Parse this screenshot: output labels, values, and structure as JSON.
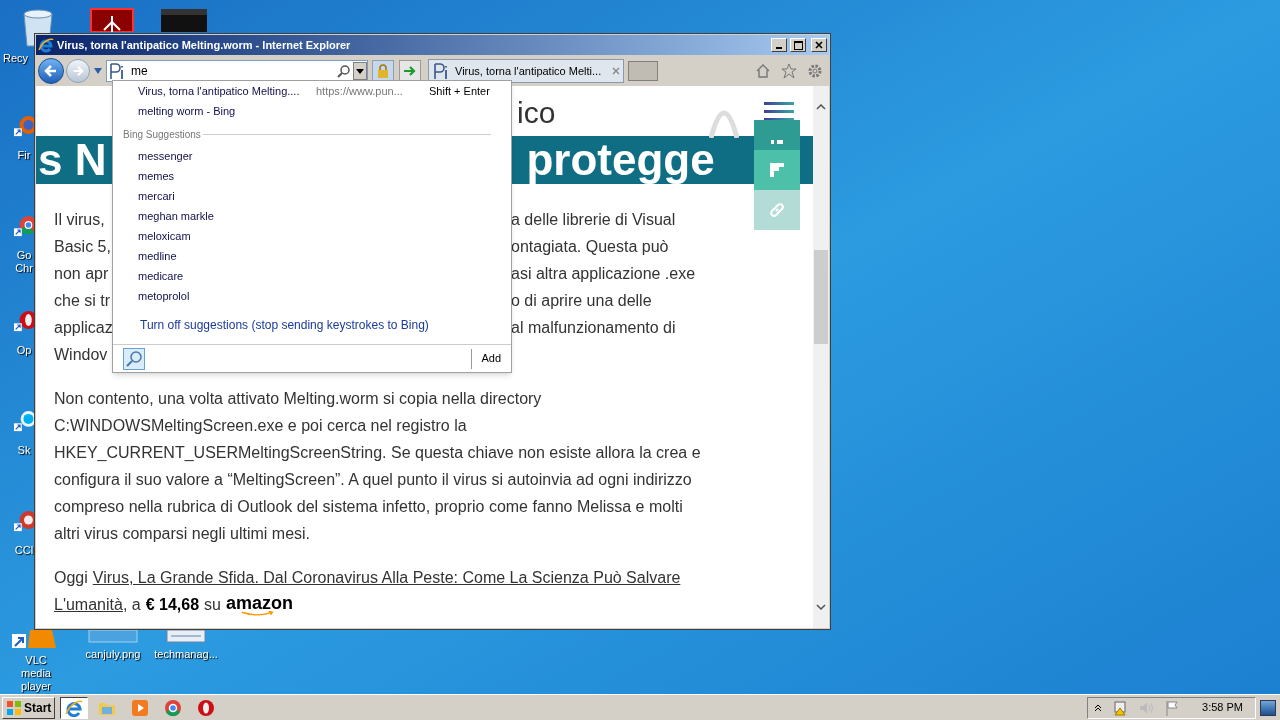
{
  "desktop": {
    "icons": [
      {
        "kind": "recycle",
        "label": "Recy"
      },
      {
        "kind": "pdf"
      },
      {
        "kind": "dark"
      },
      {
        "kind": "firefox",
        "label": "Fir"
      },
      {
        "kind": "chrome",
        "label": "Go Chr"
      },
      {
        "kind": "opera",
        "label": "Op"
      },
      {
        "kind": "skype",
        "label": "Sk"
      },
      {
        "kind": "ccleaner",
        "label": "CCl"
      },
      {
        "kind": "vlc",
        "label": "VLC media player"
      },
      {
        "kind": "image",
        "label": "canjuly.png"
      },
      {
        "kind": "doc",
        "label": "techmanag..."
      }
    ]
  },
  "window": {
    "title": "Virus, torna l'antipatico Melting.worm - Internet Explorer"
  },
  "toolbar": {
    "address": {
      "value": "me"
    },
    "tabs": [
      {
        "label": "Virus, torna l'antipatico Melti...",
        "selected": true
      }
    ]
  },
  "autocomplete": {
    "history": [
      {
        "title": "Virus, torna l'antipatico Melting....",
        "url": "https://www.pun...",
        "hint": "Shift + Enter"
      },
      {
        "title": "melting worm - Bing"
      }
    ],
    "section": "Bing Suggestions",
    "suggestions": [
      "messenger",
      "memes",
      "mercari",
      "meghan markle",
      "meloxicam",
      "medline",
      "medicare",
      "metoprolol"
    ],
    "turn_off": "Turn off suggestions (stop sending keystrokes to Bing)",
    "add": "Add"
  },
  "page": {
    "site_title": "ico",
    "banner": {
      "headline_left": "s N",
      "headline_right": "protegge"
    },
    "lines": [
      {
        "left": "Il virus,",
        "right": "a delle librerie di Visual"
      },
      {
        "left": "Basic 5,",
        "right": "ontagiata. Questa può"
      },
      {
        "left": "non apr",
        "right": "asi altra applicazione .exe"
      },
      {
        "left": "che si tr",
        "right": "o di aprire una delle"
      },
      {
        "left": "applicaz",
        "right": "al malfunzionamento di"
      },
      {
        "left": "Windov"
      }
    ],
    "paragraph": "Non contento, una volta attivato Melting.worm si copia nella directory C:WINDOWSMeltingScreen.exe e poi cerca nel registro la HKEY_CURRENT_USERMeltingScreenString. Se questa chiave non esiste allora la crea e configura il suo valore a “MeltingScreen”. A quel punto il virus si autoinvia ad ogni indirizzo compreso nella rubrica di Outlook del sistema infetto, proprio come fanno Melissa e molti altri virus comparsi negli ultimi mesi.",
    "promo": {
      "prefix": "Oggi",
      "link_lines": [
        "Virus, La Grande Sfida. Dal Coronavirus Alla Peste: Come La Scienza Può Salvare",
        "L'umanità"
      ],
      "middle": ", a",
      "price": "€ 14,68",
      "su": "su",
      "brand": "amazon"
    }
  },
  "taskbar": {
    "start": "Start",
    "apps": [
      {
        "kind": "ie",
        "selected": true
      },
      {
        "kind": "explorer",
        "selected": false
      },
      {
        "kind": "media",
        "selected": false
      },
      {
        "kind": "chrome",
        "selected": false
      },
      {
        "kind": "opera",
        "selected": false
      }
    ],
    "clock": "3:58 PM"
  }
}
